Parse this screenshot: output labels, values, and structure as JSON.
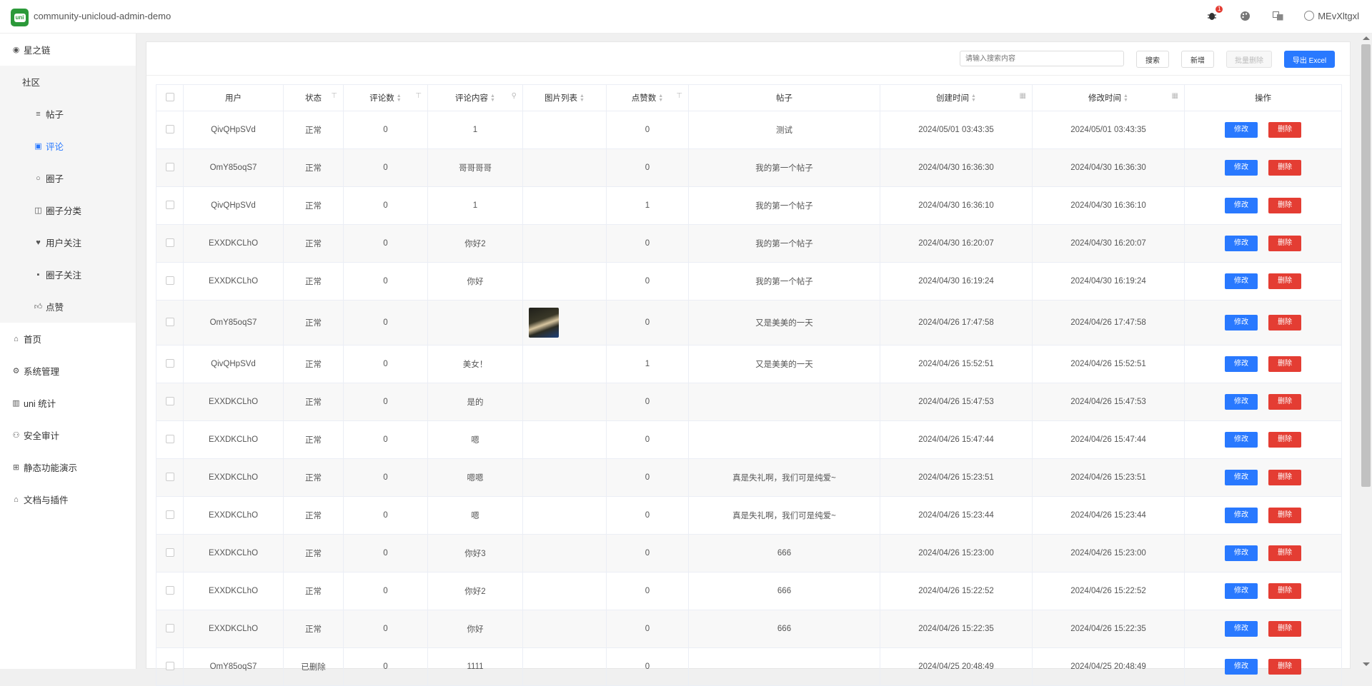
{
  "app": {
    "title": "community-unicloud-admin-demo",
    "logo_text": "uni"
  },
  "topbar": {
    "bug_badge": "1",
    "username": "MEvXltgxl"
  },
  "sidebar": {
    "items": [
      {
        "label": "星之链",
        "icon": "dot-icon"
      },
      {
        "label": "社区",
        "icon": ""
      },
      {
        "label": "帖子",
        "icon": "list-icon"
      },
      {
        "label": "评论",
        "icon": "comment-icon"
      },
      {
        "label": "圈子",
        "icon": "circle-icon"
      },
      {
        "label": "圈子分类",
        "icon": "map-icon"
      },
      {
        "label": "用户关注",
        "icon": "heart-icon"
      },
      {
        "label": "圈子关注",
        "icon": "chat-icon"
      },
      {
        "label": "点赞",
        "icon": "thumb-icon"
      },
      {
        "label": "首页",
        "icon": "home-icon"
      },
      {
        "label": "系统管理",
        "icon": "gear-icon"
      },
      {
        "label": "uni 统计",
        "icon": "chart-icon"
      },
      {
        "label": "安全审计",
        "icon": "person-icon"
      },
      {
        "label": "静态功能演示",
        "icon": "grid-icon"
      },
      {
        "label": "文档与插件",
        "icon": "plugin-icon"
      }
    ]
  },
  "toolbar": {
    "search_placeholder": "请输入搜索内容",
    "search_label": "搜索",
    "add_label": "新增",
    "batch_delete_label": "批量删除",
    "export_label": "导出 Excel"
  },
  "table": {
    "headers": {
      "user": "用户",
      "status": "状态",
      "comment_count": "评论数",
      "comment_content": "评论内容",
      "images": "图片列表",
      "like_count": "点赞数",
      "post": "帖子",
      "created": "创建时间",
      "modified": "修改时间",
      "actions": "操作"
    },
    "edit_label": "修改",
    "delete_label": "删除",
    "rows": [
      {
        "user": "QivQHpSVd",
        "status": "正常",
        "comment_count": "0",
        "content": "1",
        "has_image": false,
        "likes": "0",
        "post": "测试",
        "created": "2024/05/01 03:43:35",
        "modified": "2024/05/01 03:43:35"
      },
      {
        "user": "OmY85oqS7",
        "status": "正常",
        "comment_count": "0",
        "content": "哥哥哥哥",
        "has_image": false,
        "likes": "0",
        "post": "我的第一个帖子",
        "created": "2024/04/30 16:36:30",
        "modified": "2024/04/30 16:36:30"
      },
      {
        "user": "QivQHpSVd",
        "status": "正常",
        "comment_count": "0",
        "content": "1",
        "has_image": false,
        "likes": "1",
        "post": "我的第一个帖子",
        "created": "2024/04/30 16:36:10",
        "modified": "2024/04/30 16:36:10"
      },
      {
        "user": "EXXDKCLhO",
        "status": "正常",
        "comment_count": "0",
        "content": "你好2",
        "has_image": false,
        "likes": "0",
        "post": "我的第一个帖子",
        "created": "2024/04/30 16:20:07",
        "modified": "2024/04/30 16:20:07"
      },
      {
        "user": "EXXDKCLhO",
        "status": "正常",
        "comment_count": "0",
        "content": "你好",
        "has_image": false,
        "likes": "0",
        "post": "我的第一个帖子",
        "created": "2024/04/30 16:19:24",
        "modified": "2024/04/30 16:19:24"
      },
      {
        "user": "OmY85oqS7",
        "status": "正常",
        "comment_count": "0",
        "content": "",
        "has_image": true,
        "likes": "0",
        "post": "又是美美的一天",
        "created": "2024/04/26 17:47:58",
        "modified": "2024/04/26 17:47:58"
      },
      {
        "user": "QivQHpSVd",
        "status": "正常",
        "comment_count": "0",
        "content": "美女！",
        "has_image": false,
        "likes": "1",
        "post": "又是美美的一天",
        "created": "2024/04/26 15:52:51",
        "modified": "2024/04/26 15:52:51"
      },
      {
        "user": "EXXDKCLhO",
        "status": "正常",
        "comment_count": "0",
        "content": "是的",
        "has_image": false,
        "likes": "0",
        "post": "",
        "created": "2024/04/26 15:47:53",
        "modified": "2024/04/26 15:47:53"
      },
      {
        "user": "EXXDKCLhO",
        "status": "正常",
        "comment_count": "0",
        "content": "嗯",
        "has_image": false,
        "likes": "0",
        "post": "",
        "created": "2024/04/26 15:47:44",
        "modified": "2024/04/26 15:47:44"
      },
      {
        "user": "EXXDKCLhO",
        "status": "正常",
        "comment_count": "0",
        "content": "嗯嗯",
        "has_image": false,
        "likes": "0",
        "post": "真是失礼啊，我们可是纯爱~",
        "created": "2024/04/26 15:23:51",
        "modified": "2024/04/26 15:23:51"
      },
      {
        "user": "EXXDKCLhO",
        "status": "正常",
        "comment_count": "0",
        "content": "嗯",
        "has_image": false,
        "likes": "0",
        "post": "真是失礼啊，我们可是纯爱~",
        "created": "2024/04/26 15:23:44",
        "modified": "2024/04/26 15:23:44"
      },
      {
        "user": "EXXDKCLhO",
        "status": "正常",
        "comment_count": "0",
        "content": "你好3",
        "has_image": false,
        "likes": "0",
        "post": "666",
        "created": "2024/04/26 15:23:00",
        "modified": "2024/04/26 15:23:00"
      },
      {
        "user": "EXXDKCLhO",
        "status": "正常",
        "comment_count": "0",
        "content": "你好2",
        "has_image": false,
        "likes": "0",
        "post": "666",
        "created": "2024/04/26 15:22:52",
        "modified": "2024/04/26 15:22:52"
      },
      {
        "user": "EXXDKCLhO",
        "status": "正常",
        "comment_count": "0",
        "content": "你好",
        "has_image": false,
        "likes": "0",
        "post": "666",
        "created": "2024/04/26 15:22:35",
        "modified": "2024/04/26 15:22:35"
      },
      {
        "user": "OmY85oqS7",
        "status": "已删除",
        "comment_count": "0",
        "content": "1111",
        "has_image": false,
        "likes": "0",
        "post": "",
        "created": "2024/04/25 20:48:49",
        "modified": "2024/04/25 20:48:49"
      }
    ]
  }
}
